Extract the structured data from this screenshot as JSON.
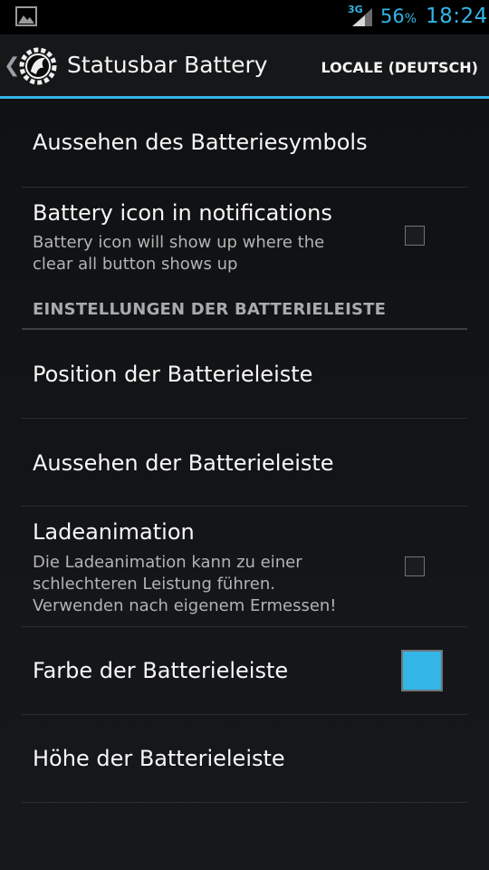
{
  "status_bar": {
    "network": "3G",
    "battery_percent": "56",
    "percent_sign": "%",
    "clock": "18:24",
    "accent": "#33b5e5",
    "icons": [
      "picture-icon",
      "signal-icon"
    ]
  },
  "action_bar": {
    "title": "Statusbar Battery",
    "action": "LOCALE (DEUTSCH)",
    "icons": [
      "up-chevron-icon",
      "app-logo-icon"
    ]
  },
  "preferences": {
    "battery_icon_look": {
      "title": "Aussehen des Batteriesymbols"
    },
    "battery_icon_notifications": {
      "title": "Battery icon in notifications",
      "summary": "Battery icon will show up where the clear all button shows up",
      "checked": false
    },
    "category_bar": "EINSTELLUNGEN DER BATTERIELEISTE",
    "bar_position": {
      "title": "Position der Batterieleiste"
    },
    "bar_look": {
      "title": "Aussehen der Batterieleiste"
    },
    "charge_animation": {
      "title": "Ladeanimation",
      "summary": "Die Ladeanimation kann zu einer schlechteren Leistung führen. Verwenden nach eigenem Ermessen!",
      "checked": false
    },
    "bar_color": {
      "title": "Farbe der Batterieleiste",
      "color": "#33b5e5"
    },
    "bar_height": {
      "title": "Höhe der Batterieleiste"
    }
  }
}
